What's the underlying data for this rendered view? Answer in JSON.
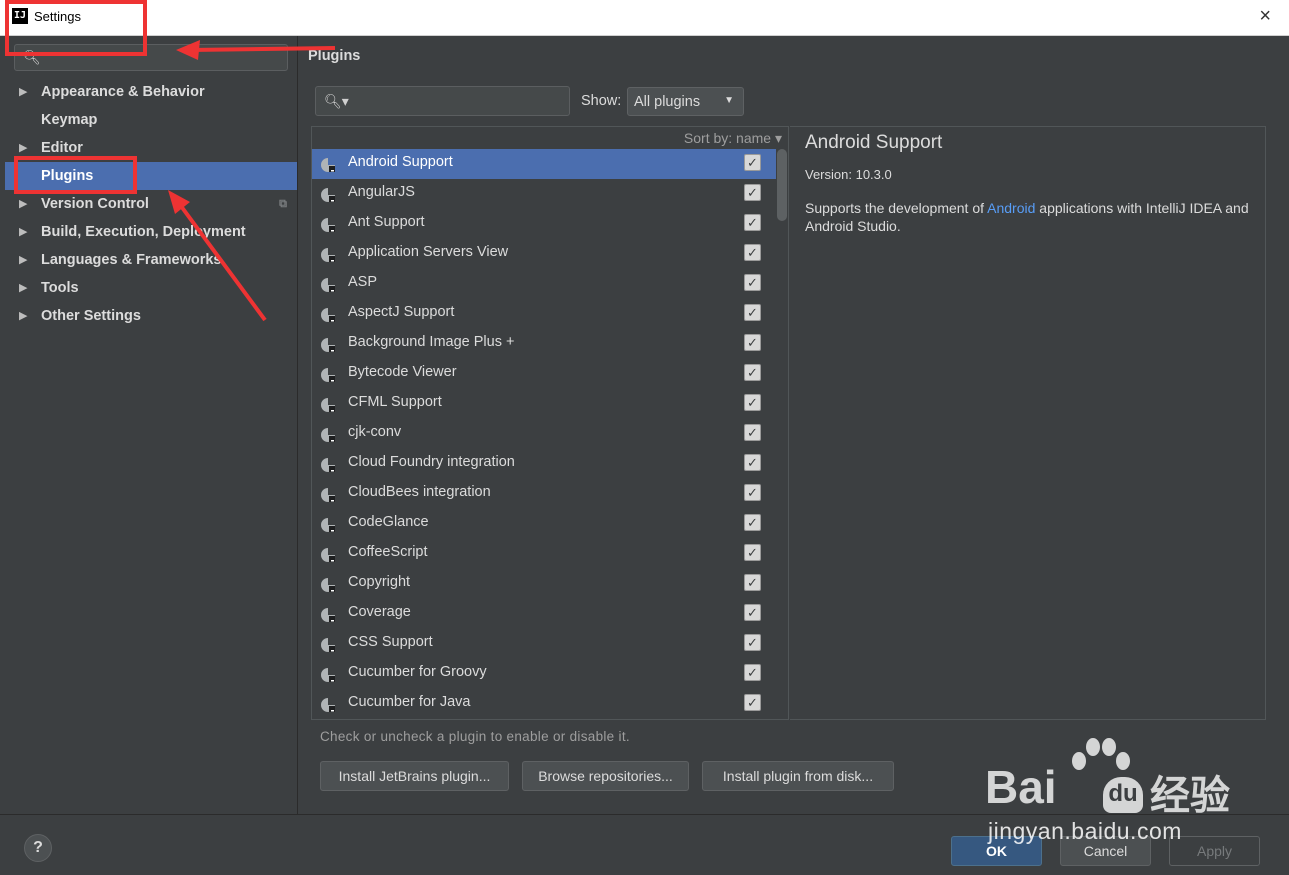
{
  "window": {
    "title": "Settings",
    "app_icon_text": "IJ",
    "close_glyph": "×"
  },
  "sidebar": {
    "search_placeholder": "",
    "items": [
      {
        "label": "Appearance & Behavior",
        "has_arrow": true
      },
      {
        "label": "Keymap",
        "has_arrow": false
      },
      {
        "label": "Editor",
        "has_arrow": true
      },
      {
        "label": "Plugins",
        "has_arrow": false,
        "selected": true
      },
      {
        "label": "Version Control",
        "has_arrow": true
      },
      {
        "label": "Build, Execution, Deployment",
        "has_arrow": true
      },
      {
        "label": "Languages & Frameworks",
        "has_arrow": true
      },
      {
        "label": "Tools",
        "has_arrow": true
      },
      {
        "label": "Other Settings",
        "has_arrow": true
      }
    ]
  },
  "main": {
    "title": "Plugins",
    "show_label": "Show:",
    "show_value": "All plugins",
    "sort_label": "Sort by: name ▾",
    "plugins": [
      {
        "name": "Android Support",
        "checked": true,
        "selected": true
      },
      {
        "name": "AngularJS",
        "checked": true
      },
      {
        "name": "Ant Support",
        "checked": true
      },
      {
        "name": "Application Servers View",
        "checked": true
      },
      {
        "name": "ASP",
        "checked": true
      },
      {
        "name": "AspectJ Support",
        "checked": true
      },
      {
        "name": "Background Image Plus +",
        "checked": true
      },
      {
        "name": "Bytecode Viewer",
        "checked": true
      },
      {
        "name": "CFML Support",
        "checked": true
      },
      {
        "name": "cjk-conv",
        "checked": true
      },
      {
        "name": "Cloud Foundry integration",
        "checked": true
      },
      {
        "name": "CloudBees integration",
        "checked": true
      },
      {
        "name": "CodeGlance",
        "checked": true
      },
      {
        "name": "CoffeeScript",
        "checked": true
      },
      {
        "name": "Copyright",
        "checked": true
      },
      {
        "name": "Coverage",
        "checked": true
      },
      {
        "name": "CSS Support",
        "checked": true
      },
      {
        "name": "Cucumber for Groovy",
        "checked": true
      },
      {
        "name": "Cucumber for Java",
        "checked": true
      }
    ],
    "detail": {
      "title": "Android Support",
      "version": "Version: 10.3.0",
      "desc_before": "Supports the development of ",
      "desc_link": "Android",
      "desc_after": " applications with IntelliJ IDEA and Android Studio."
    },
    "hint": "Check or uncheck a plugin to enable or disable it.",
    "buttons": {
      "install_jetbrains": "Install JetBrains plugin...",
      "browse": "Browse repositories...",
      "install_disk": "Install plugin from disk..."
    }
  },
  "footer": {
    "help": "?",
    "ok": "OK",
    "cancel": "Cancel",
    "apply": "Apply"
  },
  "watermark": {
    "bai": "Bai",
    "du": "du",
    "cn": "经验",
    "url": "jingyan.baidu.com"
  },
  "colors": {
    "accent": "#4b6eaf",
    "annotation": "#ee3333",
    "link": "#589df6"
  }
}
